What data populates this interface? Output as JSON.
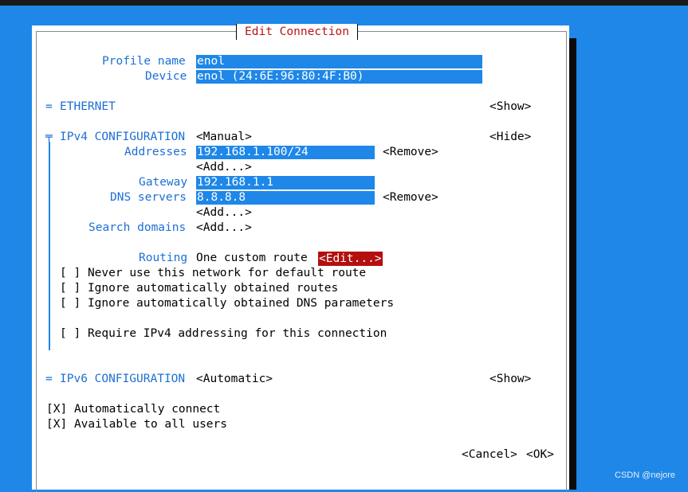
{
  "dialog": {
    "title": "Edit Connection"
  },
  "profile": {
    "profile_name_label": "Profile name",
    "profile_name_value": "enol",
    "device_label": "Device",
    "device_value": "enol (24:6E:96:80:4F:B0)"
  },
  "ethernet": {
    "marker": "=",
    "label": "ETHERNET",
    "toggle": "<Show>"
  },
  "ipv4": {
    "marker": "╤",
    "label": "IPv4 CONFIGURATION",
    "mode": "<Manual>",
    "toggle": "<Hide>",
    "addresses_label": "Addresses",
    "addresses_value": "192.168.1.100/24",
    "addresses_remove": "<Remove>",
    "addresses_add": "<Add...>",
    "gateway_label": "Gateway",
    "gateway_value": "192.168.1.1",
    "dns_label": "DNS servers",
    "dns_value": "8.8.8.8",
    "dns_remove": "<Remove>",
    "dns_add": "<Add...>",
    "search_domains_label": "Search domains",
    "search_domains_add": "<Add...>",
    "routing_label": "Routing",
    "routing_value": "One custom route",
    "routing_edit": "<Edit...>",
    "checkboxes": [
      {
        "mark": "[ ]",
        "label": "Never use this network for default route"
      },
      {
        "mark": "[ ]",
        "label": "Ignore automatically obtained routes"
      },
      {
        "mark": "[ ]",
        "label": "Ignore automatically obtained DNS parameters"
      },
      {
        "mark": "[ ]",
        "label": "Require IPv4 addressing for this connection"
      }
    ]
  },
  "ipv6": {
    "marker": "=",
    "label": "IPv6 CONFIGURATION",
    "mode": "<Automatic>",
    "toggle": "<Show>"
  },
  "options": [
    {
      "mark": "[X]",
      "label": "Automatically connect"
    },
    {
      "mark": "[X]",
      "label": "Available to all users"
    }
  ],
  "footer": {
    "cancel": "<Cancel>",
    "ok": "<OK>"
  },
  "watermark": "CSDN @nejore",
  "colors": {
    "background": "#1e87e8",
    "label": "#1d6fd4",
    "accent_red": "#b40f0f"
  }
}
